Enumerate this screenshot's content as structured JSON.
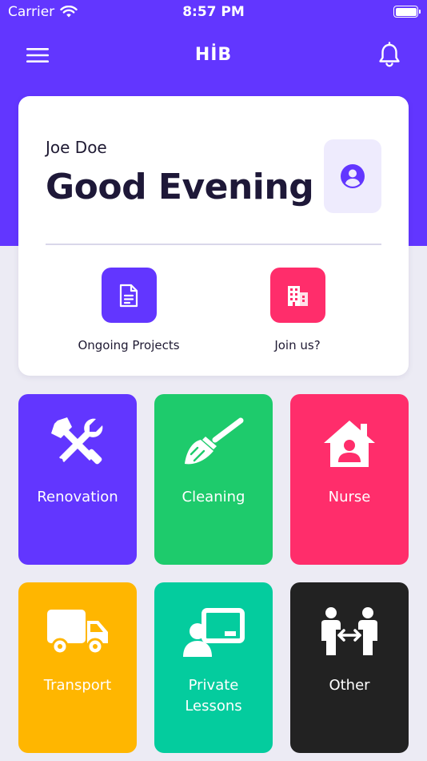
{
  "status_bar": {
    "carrier": "Carrier",
    "time": "8:57 PM"
  },
  "app_bar": {
    "title": "HİB"
  },
  "greeting_card": {
    "user_name": "Joe Doe",
    "greeting": "Good Evening",
    "actions": [
      {
        "label": "Ongoing Projects",
        "icon": "document-icon",
        "color": "#6236ff"
      },
      {
        "label": "Join us?",
        "icon": "building-icon",
        "color": "#ff2d6b"
      }
    ]
  },
  "services": [
    {
      "label": "Renovation",
      "icon": "tools-icon",
      "color": "#6236ff"
    },
    {
      "label": "Cleaning",
      "icon": "broom-icon",
      "color": "#1ecb6c"
    },
    {
      "label": "Nurse",
      "icon": "home-care-icon",
      "color": "#ff2d6b"
    },
    {
      "label": "Transport",
      "icon": "truck-icon",
      "color": "#ffb600"
    },
    {
      "label": "Private\nLessons",
      "label_lines": [
        "Private",
        "Lessons"
      ],
      "icon": "teacher-icon",
      "color": "#04cc9e"
    },
    {
      "label": "Other",
      "icon": "people-exchange-icon",
      "color": "#222222"
    }
  ],
  "colors": {
    "primary": "#6236ff",
    "background": "#ecebf4",
    "card": "#ffffff"
  }
}
